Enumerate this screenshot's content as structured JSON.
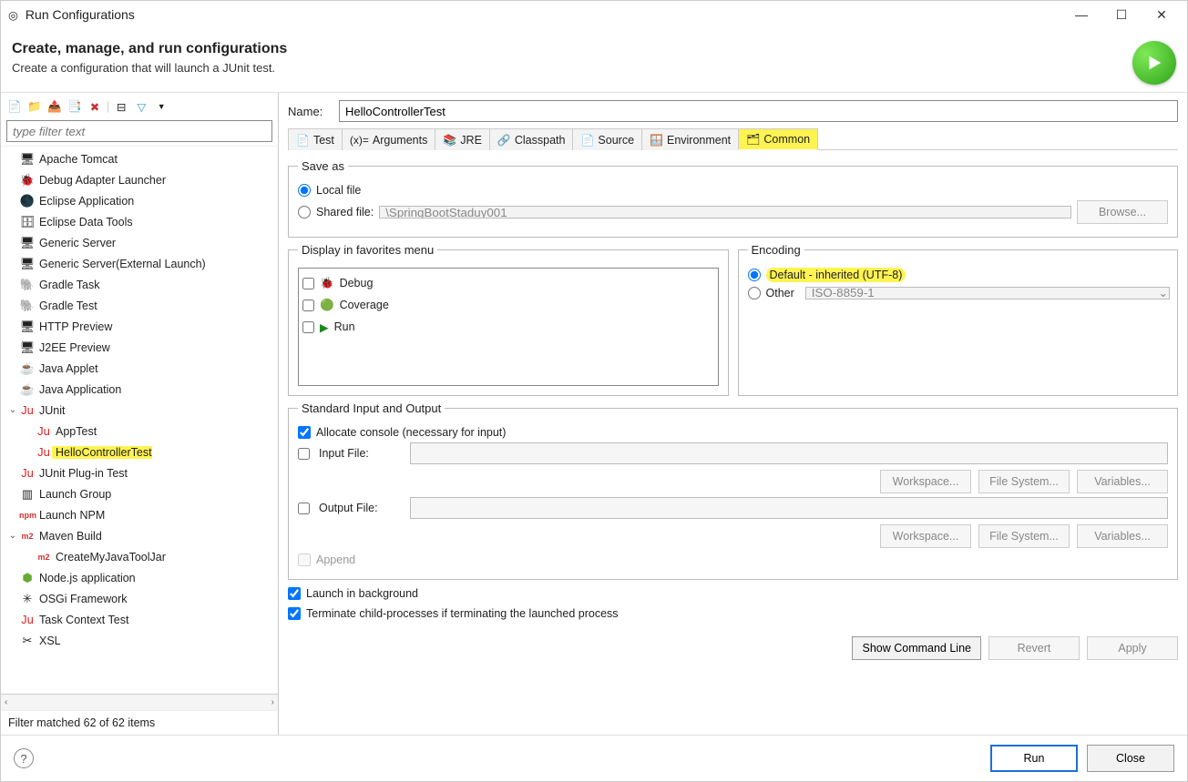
{
  "window": {
    "title": "Run Configurations"
  },
  "header": {
    "title": "Create, manage, and run configurations",
    "subtitle": "Create a configuration that will launch a JUnit test."
  },
  "filter_placeholder": "type filter text",
  "tree": [
    {
      "depth": 0,
      "icon": "🖥",
      "label": "Apache Tomcat"
    },
    {
      "depth": 0,
      "icon": "🐞",
      "label": "Debug Adapter Launcher"
    },
    {
      "depth": 0,
      "icon": "🌑",
      "label": "Eclipse Application"
    },
    {
      "depth": 0,
      "icon": "🗄",
      "label": "Eclipse Data Tools"
    },
    {
      "depth": 0,
      "icon": "🖥",
      "label": "Generic Server"
    },
    {
      "depth": 0,
      "icon": "🖥",
      "label": "Generic Server(External Launch)"
    },
    {
      "depth": 0,
      "icon": "🐘",
      "color": "#1aa36b",
      "label": "Gradle Task"
    },
    {
      "depth": 0,
      "icon": "🐘",
      "color": "#1aa36b",
      "label": "Gradle Test"
    },
    {
      "depth": 0,
      "icon": "🖥",
      "label": "HTTP Preview"
    },
    {
      "depth": 0,
      "icon": "🖥",
      "label": "J2EE Preview"
    },
    {
      "depth": 0,
      "icon": "☕",
      "label": "Java Applet"
    },
    {
      "depth": 0,
      "icon": "☕",
      "label": "Java Application"
    },
    {
      "depth": 0,
      "chev": "⌄",
      "icon": "Ju",
      "color": "#d22",
      "label": "JUnit"
    },
    {
      "depth": 1,
      "icon": "Ju",
      "color": "#d22",
      "label": "AppTest"
    },
    {
      "depth": 1,
      "icon": "Ju",
      "color": "#d22",
      "label": "HelloControllerTest",
      "selected": true
    },
    {
      "depth": 0,
      "icon": "Ju",
      "color": "#d22",
      "label": "JUnit Plug-in Test"
    },
    {
      "depth": 0,
      "icon": "▥",
      "label": "Launch Group"
    },
    {
      "depth": 0,
      "icon": "npm",
      "color": "#c33",
      "small": true,
      "label": "Launch NPM"
    },
    {
      "depth": 0,
      "chev": "⌄",
      "icon": "m2",
      "color": "#c33",
      "small": true,
      "label": "Maven Build"
    },
    {
      "depth": 1,
      "icon": "m2",
      "color": "#c33",
      "small": true,
      "label": "CreateMyJavaToolJar"
    },
    {
      "depth": 0,
      "icon": "⬢",
      "color": "#6a3",
      "label": "Node.js application"
    },
    {
      "depth": 0,
      "icon": "✳",
      "label": "OSGi Framework"
    },
    {
      "depth": 0,
      "icon": "Ju",
      "color": "#d22",
      "label": "Task Context Test"
    },
    {
      "depth": 0,
      "icon": "✂",
      "label": "XSL"
    }
  ],
  "filter_status": "Filter matched 62 of 62 items",
  "form": {
    "name_label": "Name:",
    "name_value": "HelloControllerTest"
  },
  "tabs": [
    {
      "icon": "📄",
      "label": "Test"
    },
    {
      "icon": "(x)=",
      "label": "Arguments"
    },
    {
      "icon": "📚",
      "label": "JRE"
    },
    {
      "icon": "🔗",
      "label": "Classpath"
    },
    {
      "icon": "📄",
      "label": "Source"
    },
    {
      "icon": "🪟",
      "label": "Environment"
    },
    {
      "icon": "🗂",
      "label": "Common",
      "active": true,
      "hl": true
    }
  ],
  "saveas": {
    "legend": "Save as",
    "local": "Local file",
    "shared": "Shared file:",
    "shared_path": "\\SpringBootStaduy001",
    "browse": "Browse..."
  },
  "favorites": {
    "legend": "Display in favorites menu",
    "items": [
      {
        "icon": "🐞",
        "label": "Debug"
      },
      {
        "icon": "🟢",
        "label": "Coverage"
      },
      {
        "icon": "▶",
        "color": "#1a8a1a",
        "label": "Run"
      }
    ]
  },
  "encoding": {
    "legend": "Encoding",
    "default": "Default - inherited (UTF-8)",
    "other": "Other",
    "other_value": "ISO-8859-1"
  },
  "stdio": {
    "legend": "Standard Input and Output",
    "allocate": "Allocate console (necessary for input)",
    "inputfile": "Input File:",
    "outputfile": "Output File:",
    "workspace": "Workspace...",
    "filesystem": "File System...",
    "variables": "Variables...",
    "append": "Append"
  },
  "launch_bg": "Launch in background",
  "terminate": "Terminate child-processes if terminating the launched process",
  "rightbuttons": {
    "showcmd": "Show Command Line",
    "revert": "Revert",
    "apply": "Apply"
  },
  "footer": {
    "run": "Run",
    "close": "Close"
  }
}
